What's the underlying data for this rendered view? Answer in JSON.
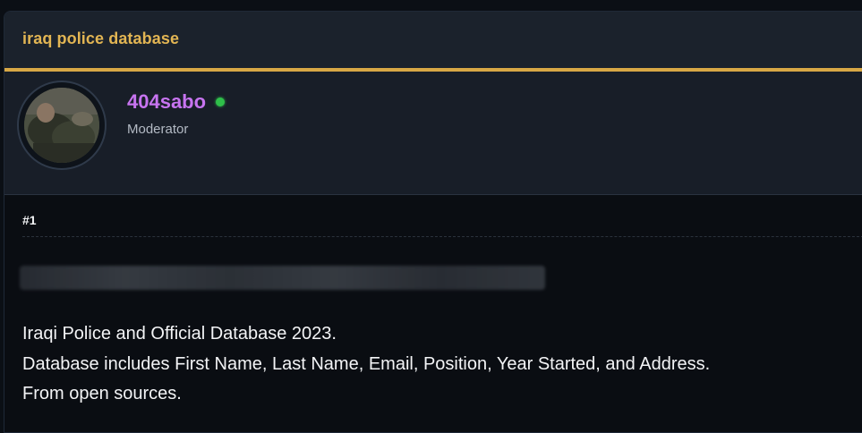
{
  "thread": {
    "title": "iraq police database"
  },
  "author": {
    "username": "404sabo",
    "role": "Moderator",
    "online": true,
    "status_color": "#2fbf4a",
    "username_color": "#c774f0"
  },
  "post": {
    "number": "#1",
    "lines": [
      "Iraqi Police and Official Database 2023.",
      "Database includes First Name, Last Name, Email, Position, Year Started, and Address.",
      "From open sources."
    ]
  },
  "theme": {
    "accent": "#d8a845",
    "title_color": "#e2b553"
  }
}
